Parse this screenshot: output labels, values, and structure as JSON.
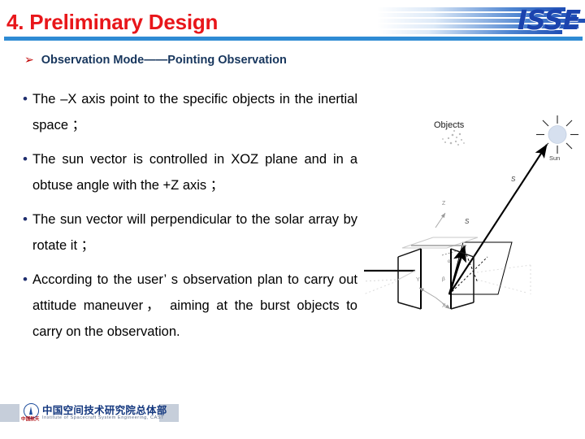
{
  "header": {
    "title": "4. Preliminary Design",
    "brand": "ISSE",
    "rule_color": "#2E8BD4",
    "title_color": "#E8161A",
    "brand_color": "#1B43AE"
  },
  "subheading": {
    "bullet": "➢",
    "text": "Observation Mode——Pointing Observation",
    "color": "#17365D"
  },
  "body": {
    "bullet_mark": "•",
    "items": [
      "The –X axis point to the specific objects in the inertial space ；",
      "The sun vector is controlled in XOZ plane and in a obtuse angle with the +Z axis ；",
      "The sun vector will perpendicular to the solar array by rotate it ；",
      "According to the user’ s observation plan to carry out attitude maneuver， aiming at the burst objects to carry on the observation."
    ]
  },
  "diagram": {
    "objects_label": "Objects",
    "sun_label": "Sun",
    "sun_vector_label": "S",
    "body_vector_label": "S",
    "axis_z_label": "Z",
    "axis_y_label": "Y",
    "axis_x_label": "X",
    "angle_label_1": "α",
    "angle_label_2": "β",
    "sun_fill": "#D6E0EF"
  },
  "footer": {
    "cn_name": "中国空间技术研究院总体部",
    "en_name": "Institute of Spacecraft System Engineering, CAST",
    "tag": "中国航天"
  }
}
